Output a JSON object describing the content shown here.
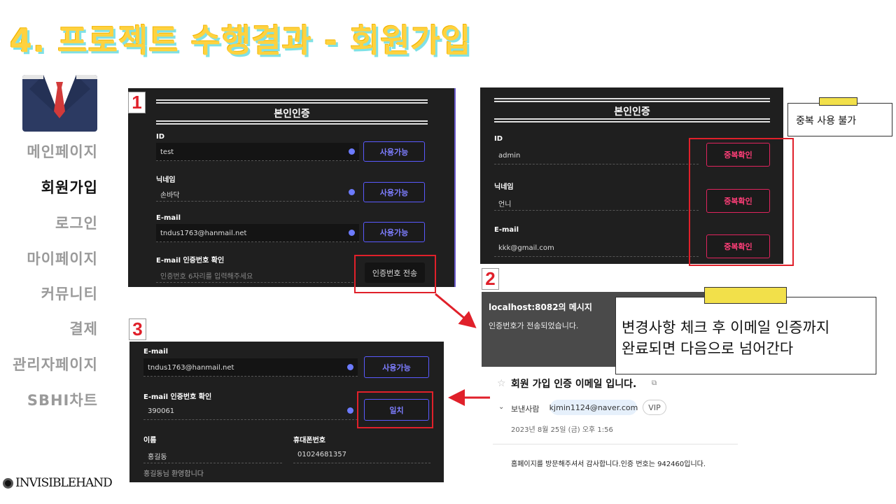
{
  "slide": {
    "title": "4. 프로젝트 수행결과 - 회원가입"
  },
  "sidebar": {
    "items": [
      {
        "label": "메인페이지",
        "active": false
      },
      {
        "label": "회원가입",
        "active": true
      },
      {
        "label": "로그인",
        "active": false
      },
      {
        "label": "마이페이지",
        "active": false
      },
      {
        "label": "커뮤니티",
        "active": false
      },
      {
        "label": "결제",
        "active": false
      },
      {
        "label": "관리자페이지",
        "active": false
      },
      {
        "label": "SBHI차트",
        "active": false
      }
    ],
    "logo": "INVISIBLEHAND"
  },
  "step_labels": {
    "one": "1",
    "two": "2",
    "three": "3"
  },
  "panel_a": {
    "section_title": "본인인증",
    "id_label": "ID",
    "id_value": "test",
    "id_button": "사용가능",
    "nick_label": "닉네임",
    "nick_value": "손바닥",
    "nick_button": "사용가능",
    "email_label": "E-mail",
    "email_value": "tndus1763@hanmail.net",
    "email_button": "사용가능",
    "verify_label": "E-mail 인증번호 확인",
    "verify_placeholder": "인증번호 6자리를 입력해주세요",
    "verify_button": "인증번호 전송"
  },
  "panel_b": {
    "section_title": "본인인증",
    "id_label": "ID",
    "id_value": "admin",
    "id_button": "중복확인",
    "nick_label": "닉네임",
    "nick_value": "언니",
    "nick_button": "중복확인",
    "email_label": "E-mail",
    "email_value": "kkk@gmail.com",
    "email_button": "중복확인"
  },
  "note_duplicate": "중복 사용 불가",
  "dialog": {
    "title": "localhost:8082의 메시지",
    "message": "인증번호가 전송되었습니다."
  },
  "note_change": {
    "line1": "변경사항 체크 후 이메일 인증까지",
    "line2": "완료되면 다음으로 넘어간다"
  },
  "panel_c": {
    "email_label": "E-mail",
    "email_value": "tndus1763@hanmail.net",
    "email_button": "사용가능",
    "verify_label": "E-mail 인증번호 확인",
    "verify_value": "390061",
    "verify_button": "일치",
    "name_label": "이름",
    "name_value": "홍길동",
    "phone_label": "휴대폰번호",
    "phone_value": "01024681357",
    "welcome": "홍길동님 환영합니다"
  },
  "email": {
    "subject": "회원 가입 인증 이메일 입니다.",
    "sender_label": "보낸사람",
    "sender": "kjmin1124@naver.com",
    "vip": "VIP",
    "date": "2023년 8월 25일 (금) 오후 1:56",
    "body": "홈페이지를 방문해주셔서 감사합니다.인증 번호는 942460입니다."
  },
  "colors": {
    "title_yellow": "#ffd23f",
    "title_shadow": "#7fe1e6",
    "highlight_red": "#e0202a",
    "panel_dark": "#1f1f1f",
    "button_blue": "#5a5aff",
    "button_red": "#e0245e",
    "note_yellow": "#f2e04a"
  }
}
